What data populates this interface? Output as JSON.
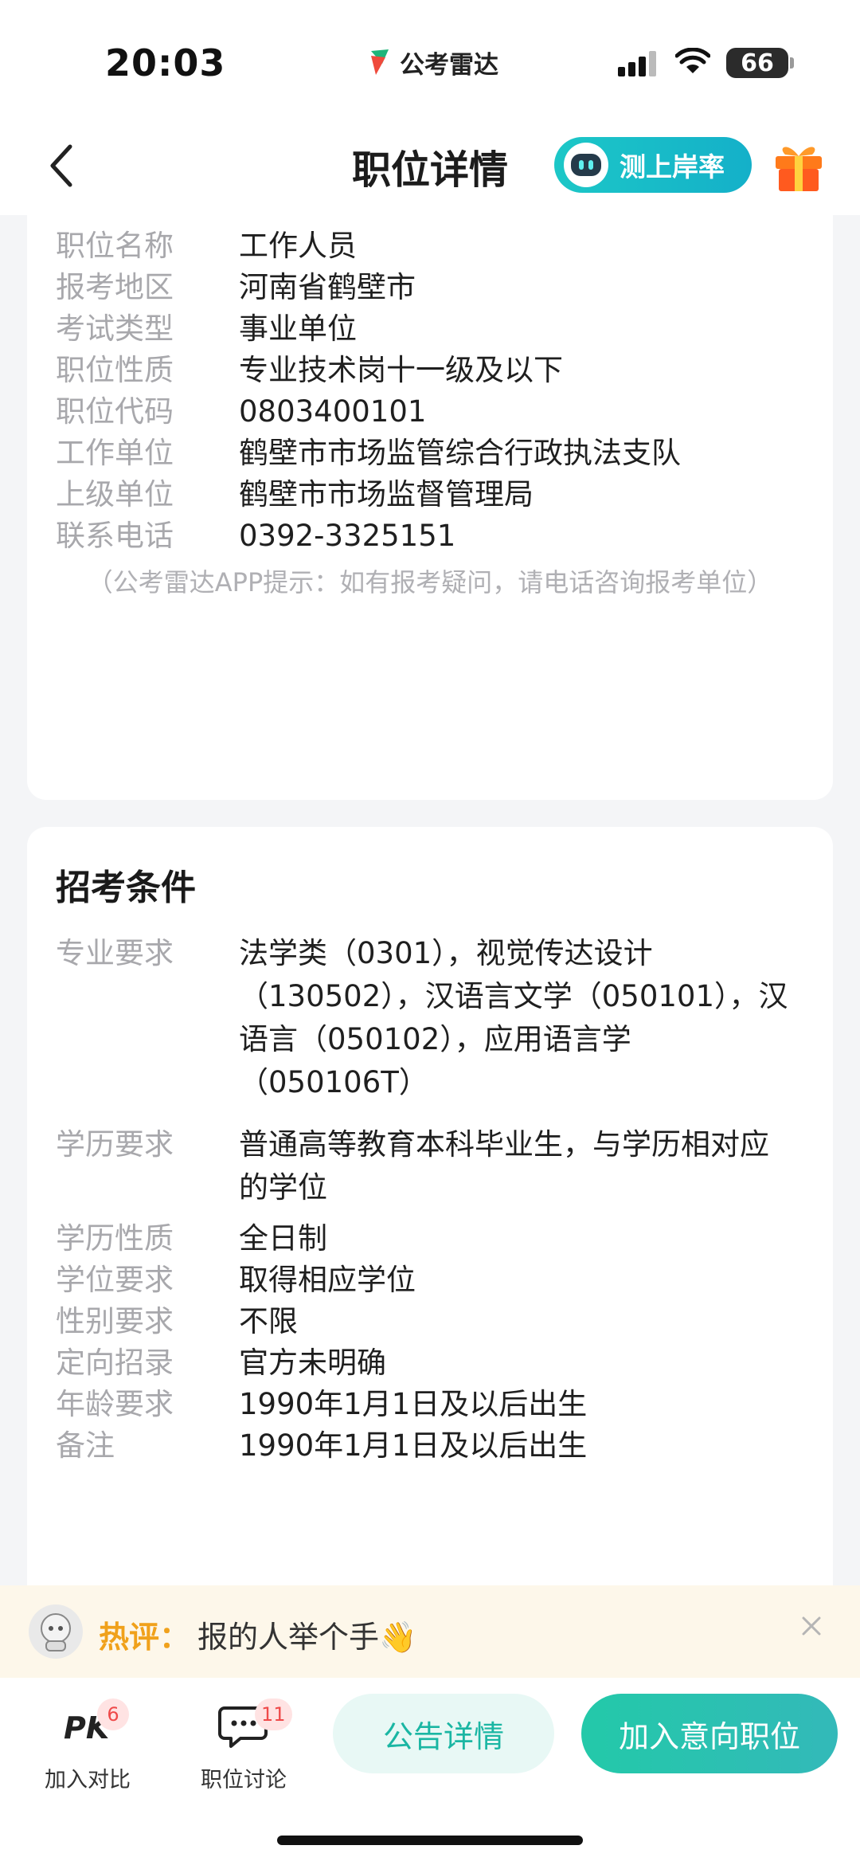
{
  "status_bar": {
    "time": "20:03",
    "app_brand": "公考雷达",
    "battery": "66"
  },
  "nav": {
    "back_icon": "chevron-left-icon",
    "title": "职位详情",
    "rate_button": "测上岸率",
    "gift_icon": "gift-icon"
  },
  "position_info": {
    "rows": [
      {
        "label": "职位名称",
        "value": "工作人员"
      },
      {
        "label": "报考地区",
        "value": "河南省鹤壁市"
      },
      {
        "label": "考试类型",
        "value": "事业单位"
      },
      {
        "label": "职位性质",
        "value": "专业技术岗十一级及以下"
      },
      {
        "label": "职位代码",
        "value": "0803400101"
      },
      {
        "label": "工作单位",
        "value": "鹤壁市市场监管综合行政执法支队"
      },
      {
        "label": "上级单位",
        "value": "鹤壁市市场监督管理局"
      },
      {
        "label": "联系电话",
        "value": "0392-3325151"
      }
    ],
    "hint": "（公考雷达APP提示：如有报考疑问，请电话咨询报考单位）"
  },
  "requirements": {
    "title": "招考条件",
    "rows": [
      {
        "label": "专业要求",
        "value": "法学类（0301），视觉传达设计（130502），汉语言文学（050101），汉语言（050102），应用语言学（050106T）"
      },
      {
        "label": "学历要求",
        "value": "普通高等教育本科毕业生，与学历相对应的学位"
      },
      {
        "label": "学历性质",
        "value": "全日制"
      },
      {
        "label": "学位要求",
        "value": "取得相应学位"
      },
      {
        "label": "性别要求",
        "value": "不限"
      },
      {
        "label": "定向招录",
        "value": "官方未明确"
      },
      {
        "label": "年龄要求",
        "value": "1990年1月1日及以后出生"
      },
      {
        "label": "备注",
        "value": "1990年1月1日及以后出生"
      }
    ]
  },
  "hot_comment": {
    "label": "热评：",
    "text": "报的人举个手👋"
  },
  "bottom_bar": {
    "compare": {
      "label": "加入对比",
      "badge": "6"
    },
    "discuss": {
      "label": "职位讨论",
      "badge": "11"
    },
    "notice_button": "公告详情",
    "join_button": "加入意向职位"
  },
  "colors": {
    "accent": "#1ab6a3",
    "hot_label": "#f0a11b",
    "badge_text": "#ef4a4a"
  }
}
